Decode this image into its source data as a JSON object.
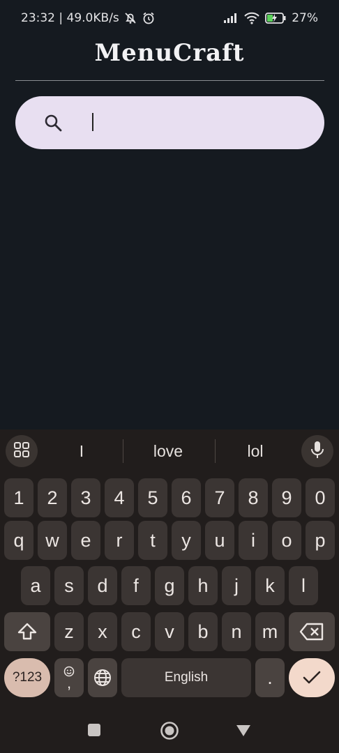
{
  "status_bar": {
    "time_speed": "23:32 | 49.0KB/s",
    "battery": "27%",
    "icons": [
      "alarm-off-icon",
      "alarm-icon",
      "signal-icon",
      "wifi-icon",
      "battery-charging-icon"
    ]
  },
  "app": {
    "title": "MenuCraft"
  },
  "search": {
    "value": "",
    "placeholder": "",
    "icon": "search-icon"
  },
  "keyboard": {
    "suggestions": [
      "I",
      "love",
      "lol"
    ],
    "row_numbers": [
      "1",
      "2",
      "3",
      "4",
      "5",
      "6",
      "7",
      "8",
      "9",
      "0"
    ],
    "row_1": [
      "q",
      "w",
      "e",
      "r",
      "t",
      "y",
      "u",
      "i",
      "o",
      "p"
    ],
    "row_2": [
      "a",
      "s",
      "d",
      "f",
      "g",
      "h",
      "j",
      "k",
      "l"
    ],
    "row_3": [
      "z",
      "x",
      "c",
      "v",
      "b",
      "n",
      "m"
    ],
    "symbols_label": "?123",
    "emoji_comma": ",",
    "space_label": "English",
    "period_label": ".",
    "accent_color": "#f3d9cb"
  },
  "nav": {
    "icons": [
      "recents-square-icon",
      "home-circle-icon",
      "back-triangle-icon"
    ]
  }
}
